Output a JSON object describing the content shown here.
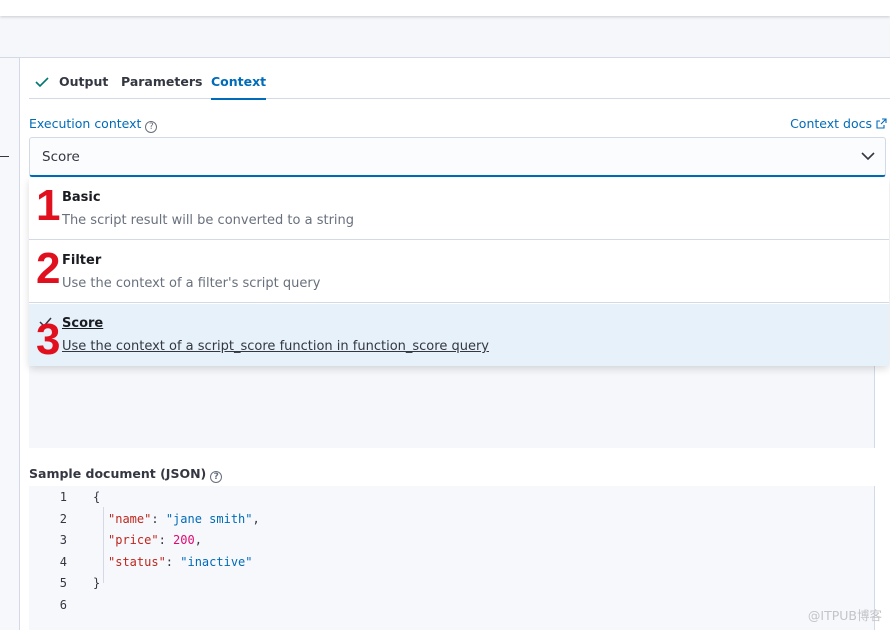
{
  "tabs": [
    {
      "label": "Output",
      "checked": true
    },
    {
      "label": "Parameters"
    },
    {
      "label": "Context",
      "active": true
    }
  ],
  "execution_context": {
    "label": "Execution context",
    "help_icon": "question-circle-icon",
    "docs_link": "Context docs",
    "selected": "Score"
  },
  "options": [
    {
      "title": "Basic",
      "desc": "The script result will be converted to a string",
      "marker": "1"
    },
    {
      "title": "Filter",
      "desc": "Use the context of a filter's script query",
      "marker": "2"
    },
    {
      "title": "Score",
      "desc": "Use the context of a script_score function in function_score query",
      "marker": "3",
      "selected": true
    }
  ],
  "sample": {
    "label": "Sample document (JSON)",
    "line_numbers": [
      "1",
      "2",
      "3",
      "4",
      "5",
      "6"
    ],
    "open_brace": "{",
    "close_brace": "}",
    "fields": [
      {
        "key": "\"name\"",
        "value": "\"jane smith\"",
        "type": "string",
        "trail": ","
      },
      {
        "key": "\"price\"",
        "value": "200",
        "type": "number",
        "trail": ","
      },
      {
        "key": "\"status\"",
        "value": "\"inactive\"",
        "type": "string",
        "trail": ""
      }
    ]
  },
  "watermark": "@ITPUB博客",
  "colors": {
    "accent": "#006bb8",
    "marker": "#e0101f",
    "selected_bg": "#e6f1fa"
  }
}
